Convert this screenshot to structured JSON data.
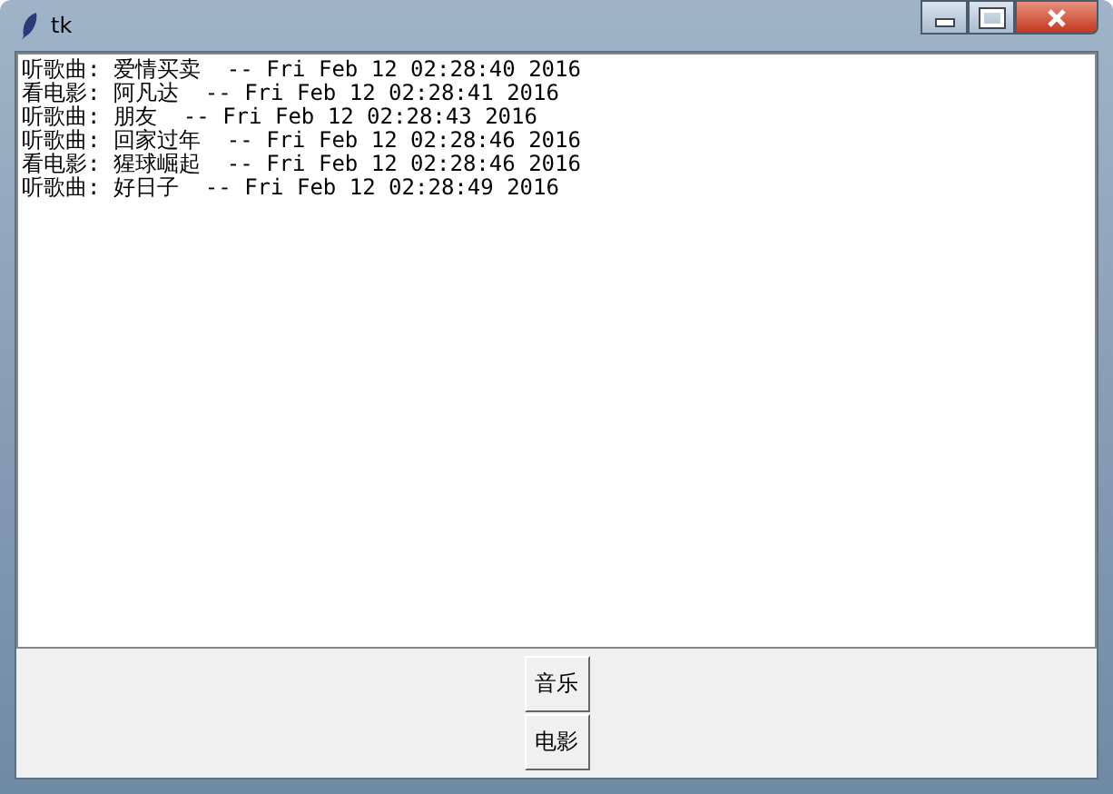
{
  "window": {
    "title": "tk"
  },
  "text_lines": [
    "听歌曲: 爱情买卖  -- Fri Feb 12 02:28:40 2016",
    "看电影: 阿凡达  -- Fri Feb 12 02:28:41 2016",
    "听歌曲: 朋友  -- Fri Feb 12 02:28:43 2016",
    "听歌曲: 回家过年  -- Fri Feb 12 02:28:46 2016",
    "看电影: 猩球崛起  -- Fri Feb 12 02:28:46 2016",
    "听歌曲: 好日子  -- Fri Feb 12 02:28:49 2016"
  ],
  "buttons": [
    "音乐",
    "电影"
  ]
}
